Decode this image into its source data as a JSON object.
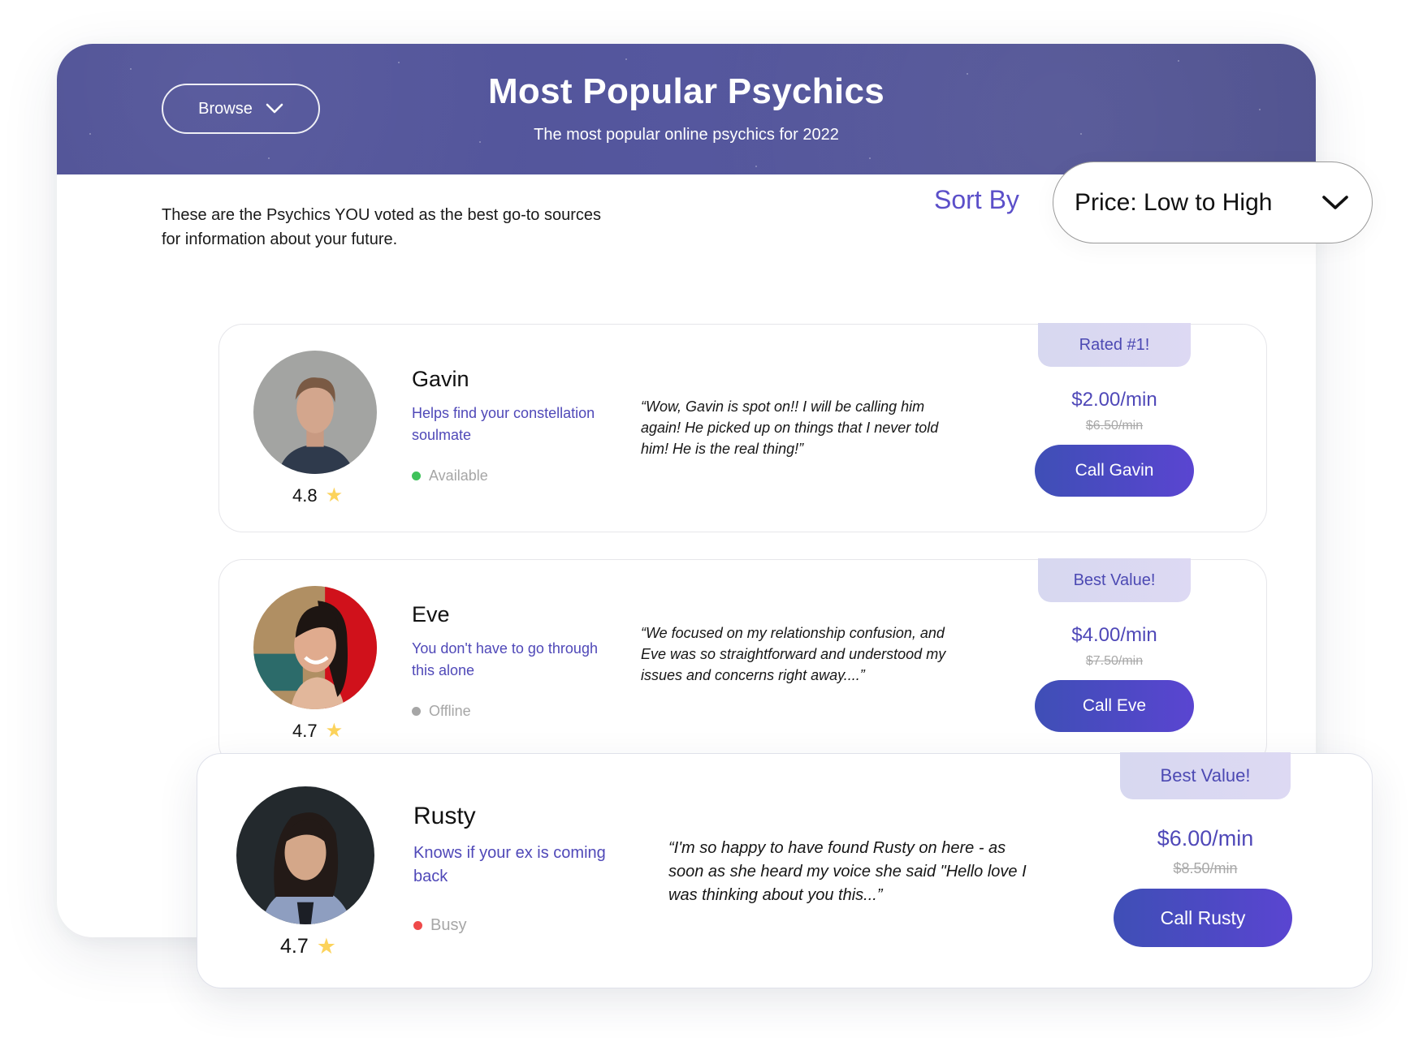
{
  "header": {
    "browse_label": "Browse",
    "title": "Most Popular Psychics",
    "subtitle": "The most popular online psychics for 2022"
  },
  "intro_text": "These are the Psychics YOU voted as the best go-to sources for information about your future.",
  "sort": {
    "label": "Sort By",
    "selected": "Price: Low to High"
  },
  "colors": {
    "accent": "#4f48b8",
    "hero_bg": "#53559a",
    "status_available": "#3fc25a",
    "status_offline": "#a6a6a6",
    "status_busy": "#ef4a4a",
    "star": "#fcd35b"
  },
  "psychics": [
    {
      "name": "Gavin",
      "tagline": "Helps find your constellation soulmate",
      "rating": "4.8",
      "status": "Available",
      "quote": "“Wow, Gavin is spot on!! I will be calling him again! He picked up on things that I never told him! He is the real thing!”",
      "badge": "Rated #1!",
      "price": "$2.00/min",
      "old_price": "$6.50/min",
      "call_label": "Call Gavin"
    },
    {
      "name": "Eve",
      "tagline": "You don't have to go through this alone",
      "rating": "4.7",
      "status": "Offline",
      "quote": "“We focused on my relationship confusion, and Eve was so straightforward and understood my issues and concerns right away....”",
      "badge": "Best Value!",
      "price": "$4.00/min",
      "old_price": "$7.50/min",
      "call_label": "Call Eve"
    },
    {
      "name": "Rusty",
      "tagline": "Knows if your ex is coming back",
      "rating": "4.7",
      "status": "Busy",
      "quote": "“I'm so happy to have found Rusty on here - as soon as she heard my voice she said \"Hello love I was thinking about you this...”",
      "badge": "Best Value!",
      "price": "$6.00/min",
      "old_price": "$8.50/min",
      "call_label": "Call Rusty"
    }
  ]
}
